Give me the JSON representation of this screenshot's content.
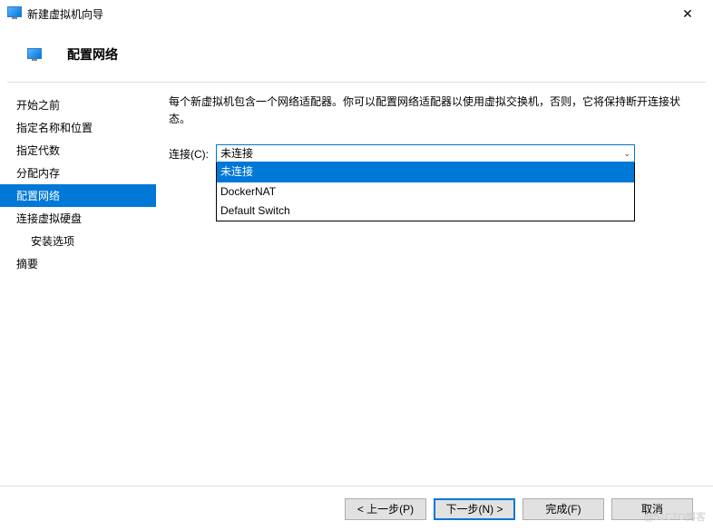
{
  "window": {
    "title": "新建虚拟机向导",
    "close_tooltip": "关闭"
  },
  "header": {
    "title": "配置网络"
  },
  "sidebar": {
    "items": [
      {
        "label": "开始之前",
        "active": false,
        "indent": false
      },
      {
        "label": "指定名称和位置",
        "active": false,
        "indent": false
      },
      {
        "label": "指定代数",
        "active": false,
        "indent": false
      },
      {
        "label": "分配内存",
        "active": false,
        "indent": false
      },
      {
        "label": "配置网络",
        "active": true,
        "indent": false
      },
      {
        "label": "连接虚拟硬盘",
        "active": false,
        "indent": false
      },
      {
        "label": "安装选项",
        "active": false,
        "indent": true
      },
      {
        "label": "摘要",
        "active": false,
        "indent": false
      }
    ]
  },
  "content": {
    "description": "每个新虚拟机包含一个网络适配器。你可以配置网络适配器以使用虚拟交换机，否则，它将保持断开连接状态。",
    "connection_label": "连接(C):",
    "dropdown": {
      "selected": "未连接",
      "options": [
        {
          "label": "未连接",
          "highlight": true
        },
        {
          "label": "DockerNAT",
          "highlight": false
        },
        {
          "label": "Default Switch",
          "highlight": false
        }
      ]
    }
  },
  "footer": {
    "prev": "< 上一步(P)",
    "next": "下一步(N) >",
    "finish": "完成(F)",
    "cancel": "取消"
  },
  "watermark": "@51CTO博客"
}
